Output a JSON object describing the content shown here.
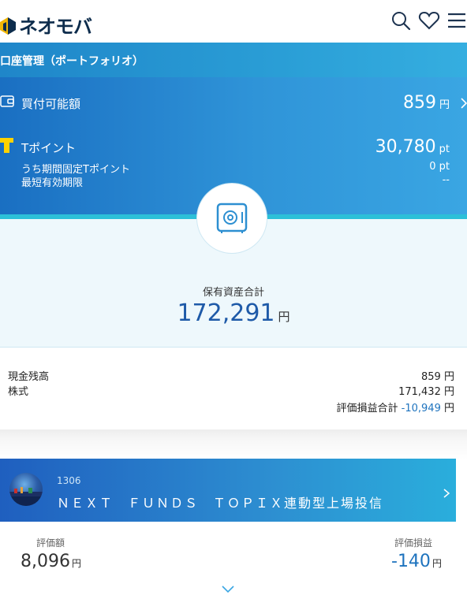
{
  "header": {
    "logo_text": "ネオモバ",
    "icons": [
      "search-icon",
      "heart-icon",
      "menu-icon"
    ]
  },
  "section": {
    "title": "口座管理（ポートフォリオ）"
  },
  "buying_power": {
    "label": "買付可能額",
    "value": "859",
    "unit": "円"
  },
  "tpoint": {
    "label": "Tポイント",
    "value": "30,780",
    "unit": "pt",
    "fixed_label": "うち期間固定Tポイント",
    "fixed_value": "0 pt",
    "expiry_label": "最短有効期限",
    "expiry_value": "--"
  },
  "total": {
    "label": "保有資産合計",
    "value": "172,291",
    "unit": "円"
  },
  "breakdown": {
    "cash_label": "現金残高",
    "cash_value": "859",
    "stock_label": "株式",
    "stock_value": "171,432",
    "pl_label": "評価損益合計",
    "pl_value": "-10,949",
    "unit": "円"
  },
  "fund": {
    "code": "1306",
    "name": "ＮＥＸＴ　ＦＵＮＤＳ　ＴＯＰＩＸ連動型上場投信",
    "valuation_label": "評価額",
    "valuation_value": "8,096",
    "pl_label": "評価損益",
    "pl_value": "-140",
    "unit": "円"
  },
  "colors": {
    "brand_navy": "#0d2c4c",
    "accent_blue": "#1e73be",
    "panel_blue": "#2f94d8",
    "teal": "#2cc0d8"
  }
}
